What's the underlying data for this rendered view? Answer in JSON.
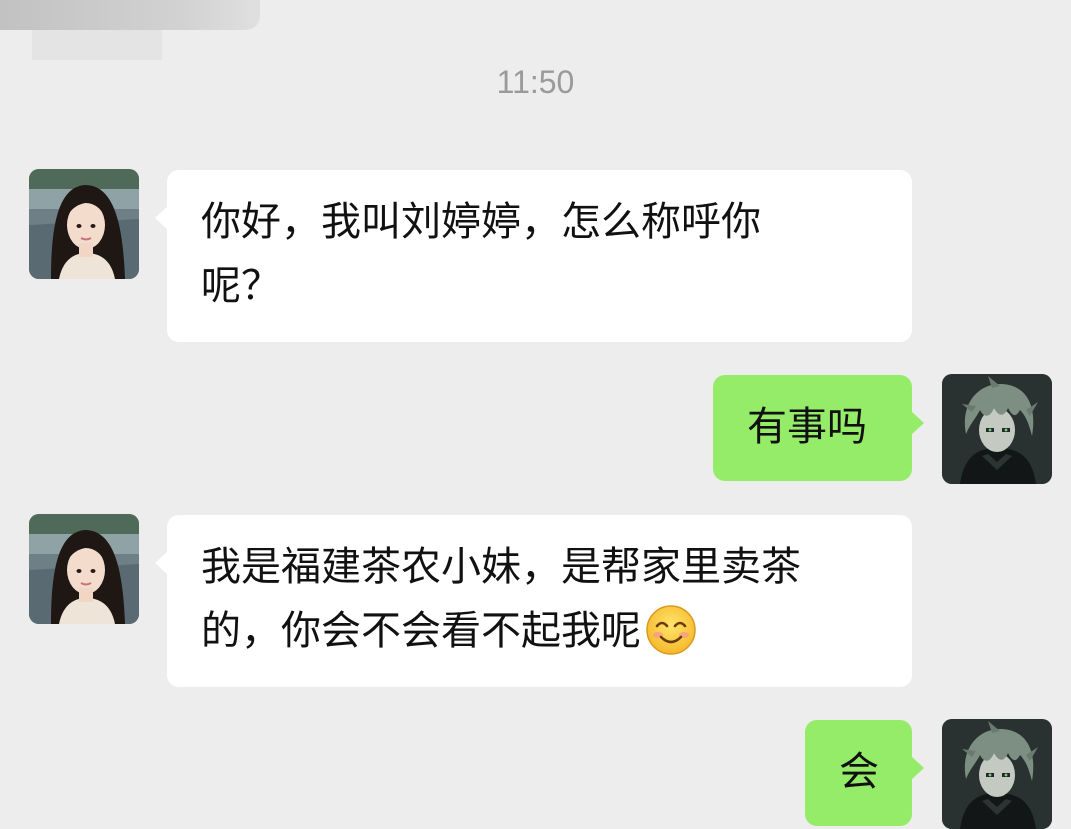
{
  "chat": {
    "timestamp": "11:50",
    "messages": [
      {
        "side": "incoming",
        "sender": "contact",
        "lines": [
          "你好，我叫刘婷婷，怎么称呼你",
          "呢？"
        ]
      },
      {
        "side": "outgoing",
        "sender": "me",
        "lines": [
          "有事吗"
        ]
      },
      {
        "side": "incoming",
        "sender": "contact",
        "lines": [
          "我是福建茶农小妹，是帮家里卖茶",
          "的，你会不会看不起我呢"
        ],
        "trailing_emoji": "smiling-face-emoji"
      },
      {
        "side": "outgoing",
        "sender": "me",
        "lines": [
          "会"
        ]
      }
    ]
  },
  "colors": {
    "background": "#ededed",
    "incoming_bubble": "#ffffff",
    "outgoing_bubble": "#95ec69",
    "timestamp_text": "#9a9a9a"
  },
  "icons": {
    "contact_avatar": "girl-avatar",
    "my_avatar": "anime-boy-avatar"
  }
}
